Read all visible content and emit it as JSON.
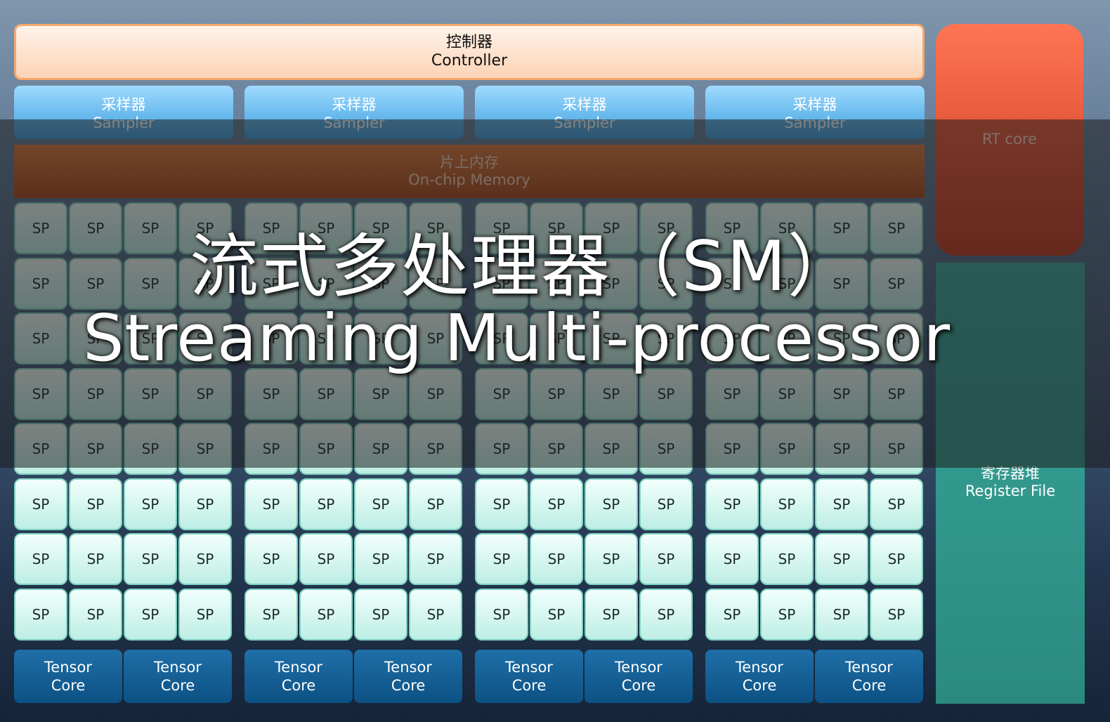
{
  "controller": {
    "cn": "控制器",
    "en": "Controller"
  },
  "samplers": [
    {
      "cn": "采样器",
      "en": "Sampler"
    },
    {
      "cn": "采样器",
      "en": "Sampler"
    },
    {
      "cn": "采样器",
      "en": "Sampler"
    },
    {
      "cn": "采样器",
      "en": "Sampler"
    }
  ],
  "memory": {
    "cn": "片上内存",
    "en": "On-chip Memory"
  },
  "rt_core": {
    "label": "RT core"
  },
  "register_file": {
    "cn": "寄存器堆",
    "en": "Register File"
  },
  "sp_label": "SP",
  "sp_grid": {
    "groups": 4,
    "rows": 8,
    "cols": 4
  },
  "tensor_core": {
    "line1": "Tensor",
    "line2": "Core"
  },
  "title": {
    "cn": "流式多处理器（SM）",
    "en": "Streaming Multi-processor"
  },
  "colors": {
    "controller_border": "#f7a66c",
    "sampler": "#3d9fde",
    "memory": "#a9491c",
    "rt_core": "#e35638",
    "register_file": "#2a8a80",
    "sp_fill": "#bdeee4",
    "tensor_core": "#0c5184"
  }
}
